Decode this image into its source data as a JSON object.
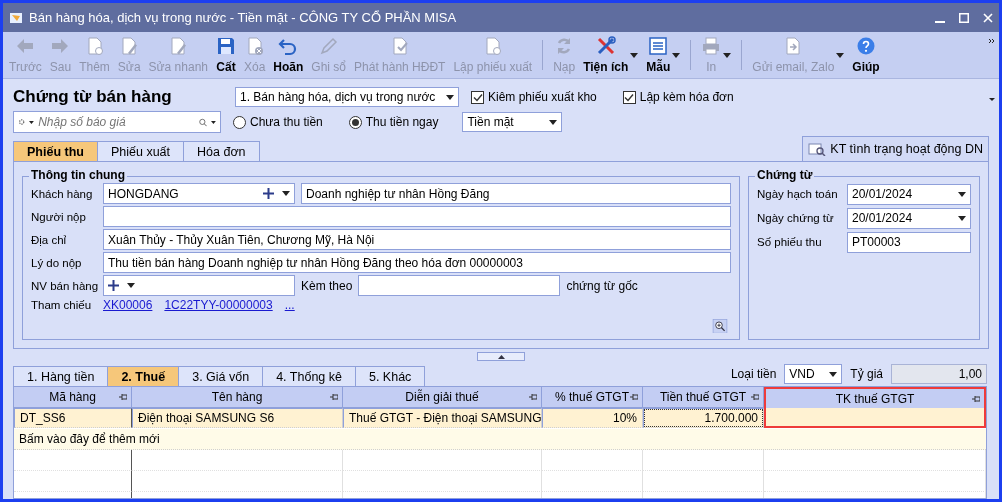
{
  "window": {
    "title": "Bán hàng hóa, dịch vụ trong nước - Tiền mặt - CÔNG TY CỔ PHẦN MISA"
  },
  "toolbar": [
    {
      "label": "Trước",
      "kind": "arrow-left",
      "disabled": true,
      "dropdown": false,
      "separator_before": false
    },
    {
      "label": "Sau",
      "kind": "arrow-right",
      "disabled": true,
      "dropdown": false,
      "separator_before": false
    },
    {
      "label": "Thêm",
      "kind": "doc-add",
      "disabled": true,
      "dropdown": false,
      "separator_before": false
    },
    {
      "label": "Sửa",
      "kind": "doc-edit",
      "disabled": true,
      "dropdown": false,
      "separator_before": false
    },
    {
      "label": "Sửa nhanh",
      "kind": "doc-edit",
      "disabled": true,
      "dropdown": false,
      "separator_before": false
    },
    {
      "label": "Cất",
      "kind": "save",
      "disabled": false,
      "dropdown": false,
      "separator_before": false
    },
    {
      "label": "Xóa",
      "kind": "doc-delete",
      "disabled": true,
      "dropdown": false,
      "separator_before": false
    },
    {
      "label": "Hoãn",
      "kind": "undo",
      "disabled": false,
      "dropdown": false,
      "separator_before": false
    },
    {
      "label": "Ghi sổ",
      "kind": "pencil",
      "disabled": true,
      "dropdown": false,
      "separator_before": false
    },
    {
      "label": "Phát hành HĐĐT",
      "kind": "doc-check",
      "disabled": true,
      "dropdown": false,
      "separator_before": false
    },
    {
      "label": "Lập phiếu xuất",
      "kind": "doc-add",
      "disabled": true,
      "dropdown": false,
      "separator_before": false
    },
    {
      "label": "Nạp",
      "kind": "refresh",
      "disabled": true,
      "dropdown": false,
      "separator_before": true
    },
    {
      "label": "Tiện ích",
      "kind": "tools",
      "disabled": false,
      "dropdown": true,
      "separator_before": false
    },
    {
      "label": "Mẫu",
      "kind": "list",
      "disabled": false,
      "dropdown": true,
      "separator_before": false
    },
    {
      "label": "In",
      "kind": "printer",
      "disabled": true,
      "dropdown": true,
      "separator_before": true
    },
    {
      "label": "Gửi email, Zalo",
      "kind": "doc-send",
      "disabled": true,
      "dropdown": true,
      "separator_before": true
    },
    {
      "label": "Giúp",
      "kind": "help",
      "disabled": false,
      "dropdown": false,
      "separator_before": false
    }
  ],
  "header": {
    "title": "Chứng từ bán hàng",
    "type_select": "1. Bán hàng hóa, dịch vụ trong nước",
    "checkboxes": [
      {
        "label": "Kiêm phiếu xuất kho",
        "checked": true
      },
      {
        "label": "Lập kèm hóa đơn",
        "checked": true
      }
    ],
    "quote_search": {
      "placeholder": "Nhập số báo giá"
    },
    "radios": [
      {
        "label": "Chưa thu tiền",
        "selected": false
      },
      {
        "label": "Thu tiền ngay",
        "selected": true
      }
    ],
    "payment_select": "Tiền mặt"
  },
  "doc_tabs": [
    {
      "label": "Phiếu thu",
      "selected": true
    },
    {
      "label": "Phiếu xuất",
      "selected": false
    },
    {
      "label": "Hóa đơn",
      "selected": false
    }
  ],
  "check_button": "KT tình trạng hoạt động DN",
  "general": {
    "legend": "Thông tin chung",
    "rows": [
      {
        "kind": "customer",
        "label": "Khách hàng",
        "code": "HONGDANG",
        "name": "Doanh nghiệp tư nhân Hồng Đăng"
      },
      {
        "kind": "text",
        "label": "Người nộp"
      },
      {
        "kind": "text",
        "label": "Địa chỉ",
        "value": "Xuân Thủy - Thủy Xuân Tiên, Chương Mỹ, Hà Nội"
      },
      {
        "kind": "text",
        "label": "Lý do nộp",
        "value": "Thu tiền bán hàng Doanh nghiệp tư nhân Hồng Đăng theo hóa đơn 00000003"
      },
      {
        "kind": "staff",
        "label": "NV bán hàng",
        "attach_label": "Kèm theo",
        "attach_suffix": "chứng từ gốc"
      },
      {
        "kind": "links",
        "label": "Tham chiếu",
        "links": [
          "XK00006",
          "1C22TYY-00000003",
          "..."
        ]
      }
    ]
  },
  "voucher": {
    "legend": "Chứng từ",
    "rows": [
      {
        "kind": "date",
        "label": "Ngày hạch toán",
        "value": "20/01/2024"
      },
      {
        "kind": "date",
        "label": "Ngày chứng từ",
        "value": "20/01/2024"
      },
      {
        "kind": "text",
        "label": "Số phiếu thu",
        "value": "PT00003"
      }
    ]
  },
  "grid_tabs": [
    {
      "label": "1. Hàng tiền",
      "selected": false
    },
    {
      "label": "2. Thuế",
      "selected": true
    },
    {
      "label": "3. Giá vốn",
      "selected": false
    },
    {
      "label": "4. Thống kê",
      "selected": false
    },
    {
      "label": "5. Khác",
      "selected": false
    }
  ],
  "currency": {
    "label": "Loại tiền",
    "value": "VND",
    "rate_label": "Tỷ giá",
    "rate": "1,00"
  },
  "table": {
    "columns": [
      {
        "label": "Mã hàng",
        "numeric": false,
        "highlighted": false
      },
      {
        "label": "Tên hàng",
        "numeric": false,
        "highlighted": false
      },
      {
        "label": "Diễn giải thuế",
        "numeric": false,
        "highlighted": false
      },
      {
        "label": "% thuế GTGT",
        "numeric": true,
        "highlighted": false
      },
      {
        "label": "Tiền thuế GTGT",
        "numeric": true,
        "highlighted": false
      },
      {
        "label": "TK thuế GTGT",
        "numeric": false,
        "highlighted": true
      }
    ],
    "rows": [
      {
        "selected": true,
        "cells": [
          "DT_SS6",
          "Điện thoại SAMSUNG S6",
          "Thuế GTGT - Điện thoại SAMSUNG",
          "10%",
          "1.700.000"
        ]
      }
    ],
    "add_row_text": "Bấm vào đây để thêm mới"
  }
}
